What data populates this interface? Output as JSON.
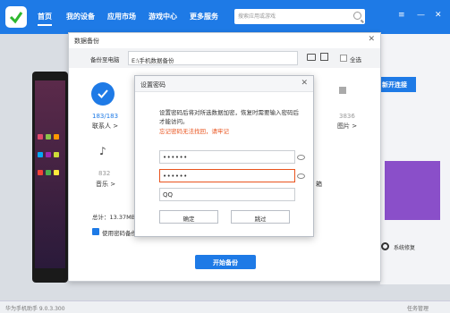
{
  "nav": {
    "home": "首页",
    "mydevice": "我的设备",
    "appmarket": "应用市场",
    "gamecenter": "游戏中心",
    "more": "更多服务"
  },
  "search": {
    "placeholder": "搜索应用或游戏"
  },
  "status": {
    "version": "华为手机助手 9.0.3.300",
    "tasks": "任务管理"
  },
  "side": {
    "connect_button": "新开连接",
    "system_repair": "系统修复"
  },
  "backup": {
    "title": "数据备份",
    "backup_to_pc_label": "备份至电脑",
    "path": "E:\\手机数据备份",
    "select_all": "全选",
    "contacts": {
      "count": "183/183",
      "name": "联系人 >"
    },
    "pictures": {
      "count": "3836",
      "name": "图片 >"
    },
    "music": {
      "count": "832",
      "name": "音乐 >"
    },
    "partial_box": "箱",
    "total": "总计：13.37MB",
    "use_password_label": "使用密码备份",
    "start_button": "开始备份"
  },
  "password_dialog": {
    "title": "设置密码",
    "description": "设置密码后将对所选数据加密，恢复时需要输入密码后才能访问。",
    "warning": "忘记密码无法找回，请牢记",
    "password_value": "••••••",
    "confirm_value": "••••••",
    "hint_value": "QQ",
    "ok_button": "确定",
    "skip_button": "跳过"
  },
  "colors": {
    "accent": "#1e7ae6",
    "warning": "#e9531d"
  }
}
